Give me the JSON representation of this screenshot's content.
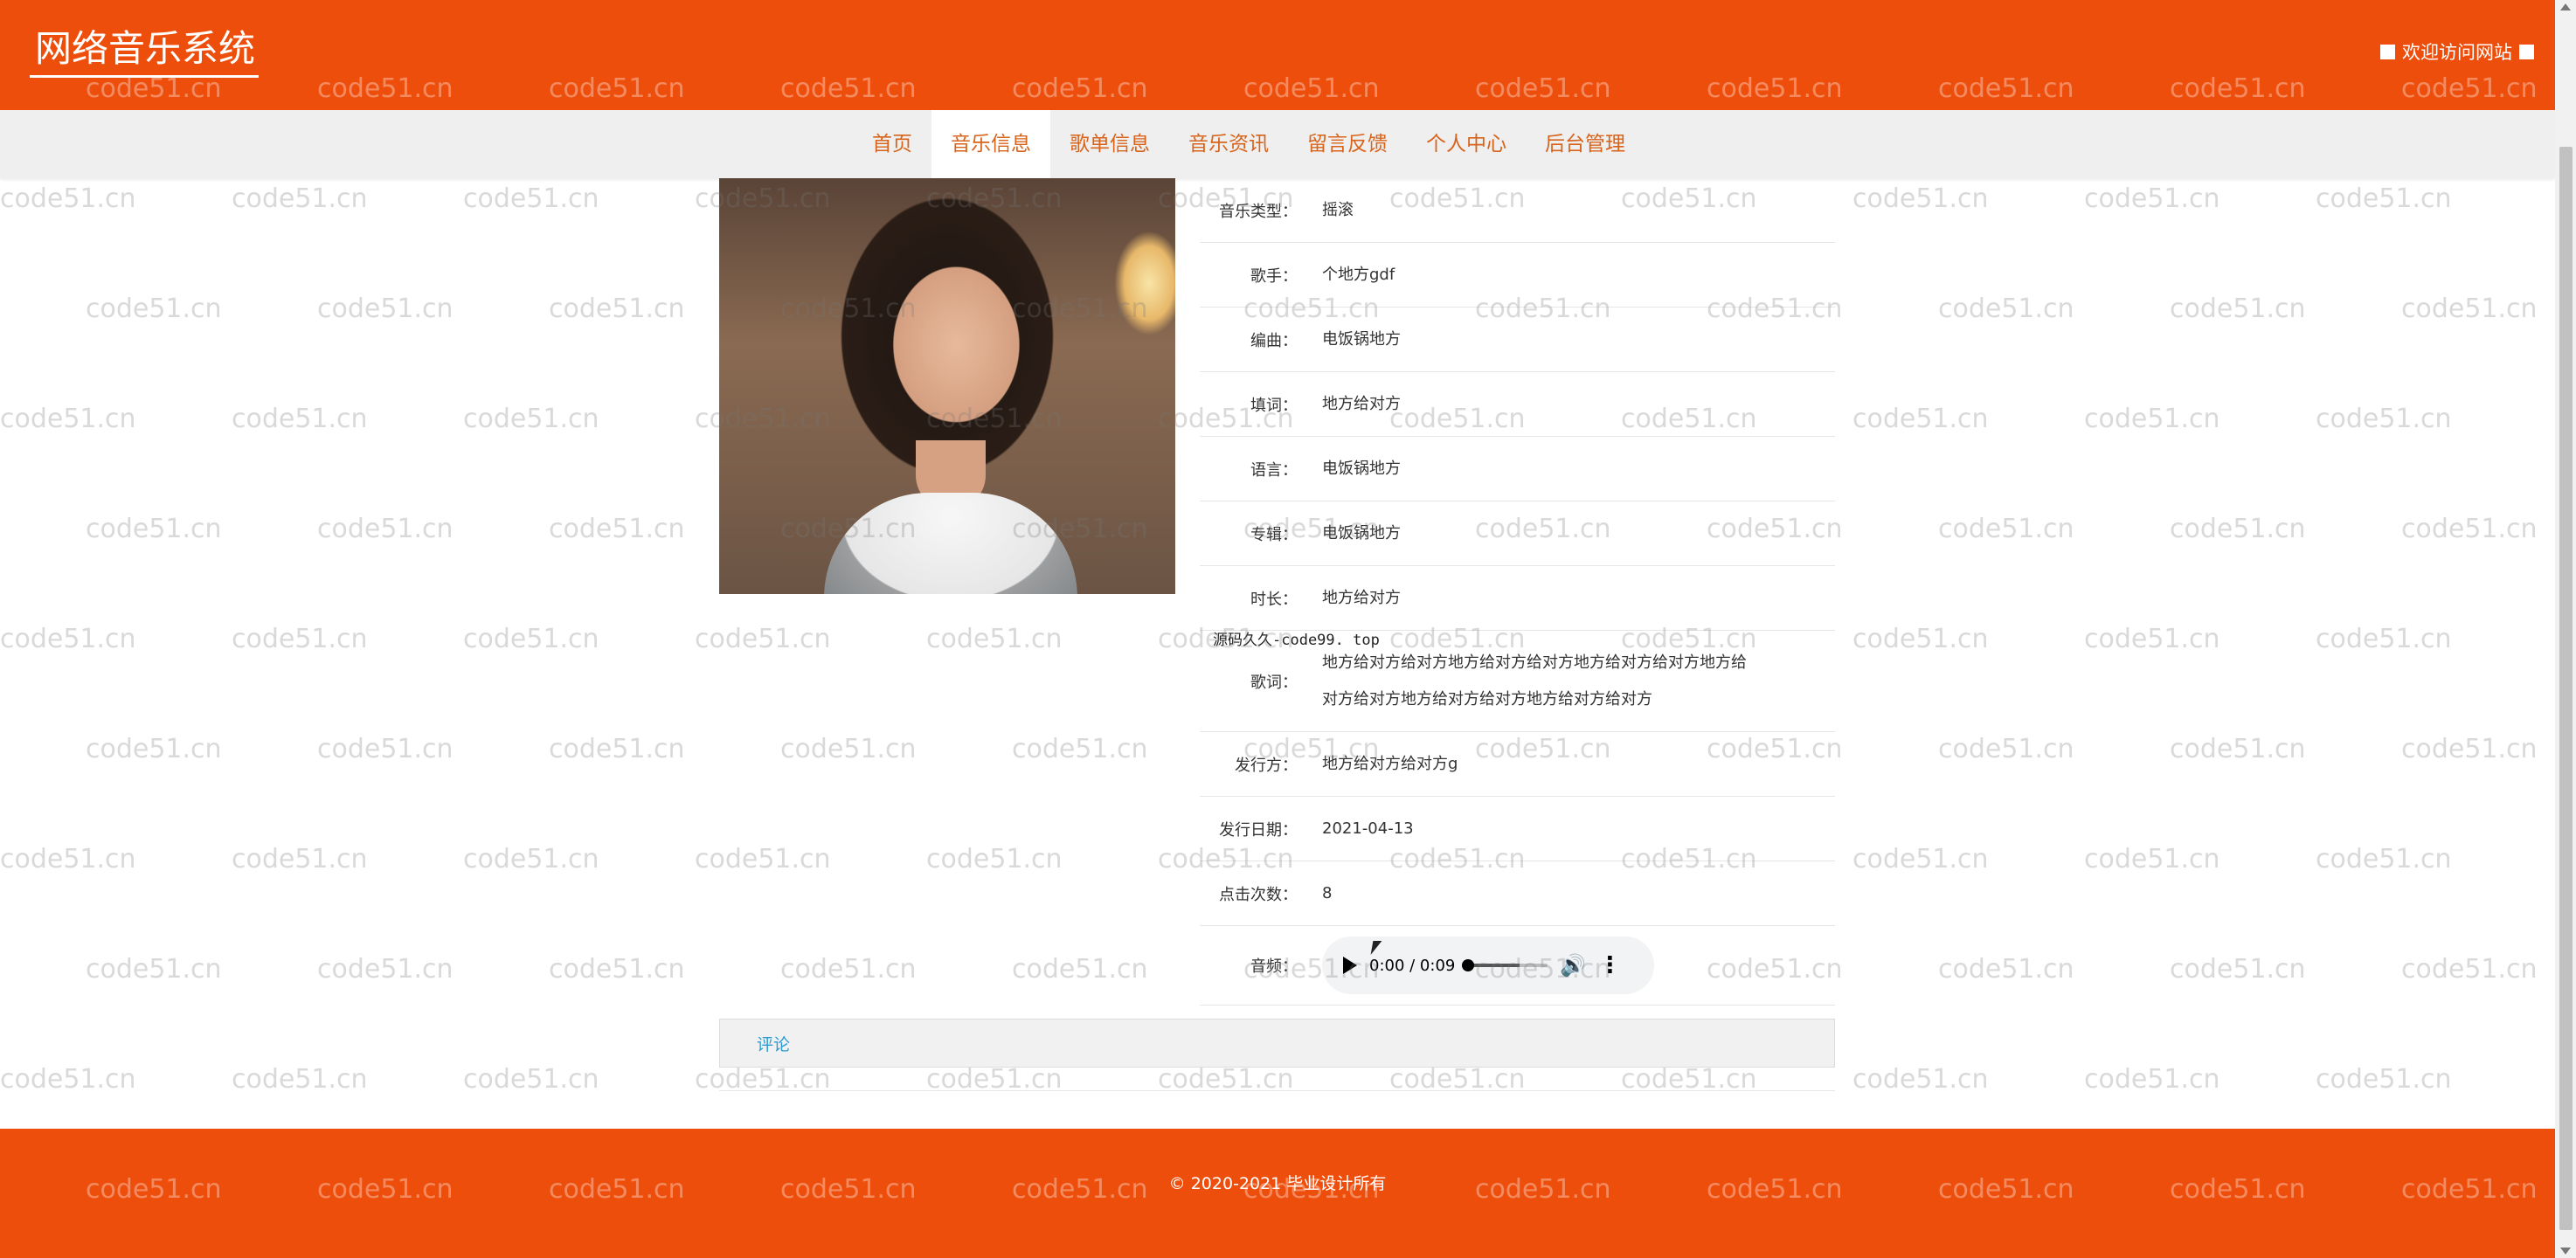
{
  "header": {
    "site_title": "网络音乐系统",
    "welcome_text": "欢迎访问网站",
    "accent_color": "#ee4e0b"
  },
  "nav": {
    "items": [
      {
        "label": "首页",
        "active": false
      },
      {
        "label": "音乐信息",
        "active": true
      },
      {
        "label": "歌单信息",
        "active": false
      },
      {
        "label": "音乐资讯",
        "active": false
      },
      {
        "label": "留言反馈",
        "active": false
      },
      {
        "label": "个人中心",
        "active": false
      },
      {
        "label": "后台管理",
        "active": false
      }
    ]
  },
  "detail": {
    "rows": [
      {
        "label": "音乐类型：",
        "value": "摇滚"
      },
      {
        "label": "歌手：",
        "value": "个地方gdf"
      },
      {
        "label": "编曲：",
        "value": "电饭锅地方"
      },
      {
        "label": "填词：",
        "value": "地方给对方"
      },
      {
        "label": "语言：",
        "value": "电饭锅地方"
      },
      {
        "label": "专辑：",
        "value": "电饭锅地方"
      },
      {
        "label": "时长：",
        "value": "地方给对方"
      }
    ],
    "lyrics_label": "歌词：",
    "lyrics_line1": "地方给对方给对方地方给对方给对方地方给对方给对方地方给",
    "lyrics_line2": "对方给对方地方给对方给对方地方给对方给对方",
    "rows_after": [
      {
        "label": "发行方：",
        "value": "地方给对方给对方g"
      },
      {
        "label": "发行日期：",
        "value": "2021-04-13"
      },
      {
        "label": "点击次数：",
        "value": "8"
      }
    ],
    "audio_label": "音频：",
    "audio_time": "0:00 / 0:09"
  },
  "inline_watermark": "源码久久-code99. top",
  "comment_label": "评论",
  "footer_text": "© 2020-2021 毕业设计所有",
  "watermark_text": "code51.cn"
}
